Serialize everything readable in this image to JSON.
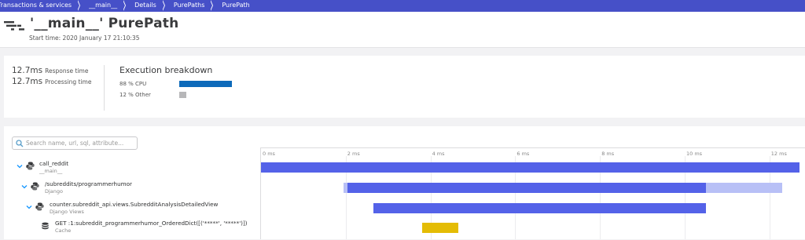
{
  "breadcrumb": [
    {
      "label": "Transactions & services"
    },
    {
      "label": "__main__"
    },
    {
      "label": "Details"
    },
    {
      "label": "PurePaths"
    },
    {
      "label": "PurePath"
    }
  ],
  "header": {
    "title": "'__main__' PurePath",
    "start_time": "Start time: 2020 January 17 21:10:35"
  },
  "summary": {
    "response_time": {
      "value": "12.7ms",
      "label": "Response time"
    },
    "processing_time": {
      "value": "12.7ms",
      "label": "Processing time"
    },
    "breakdown": {
      "title": "Execution breakdown",
      "rows": [
        {
          "label": "88 % CPU",
          "percent": 88,
          "color": "#0d6aba"
        },
        {
          "label": "12 % Other",
          "percent": 12,
          "color": "#b7b7b9"
        }
      ]
    }
  },
  "search": {
    "placeholder": "Search name, url, sql, attribute...",
    "value": ""
  },
  "timeline": {
    "ticks": [
      "0 ms",
      "2 ms",
      "4 ms",
      "6 ms",
      "8 ms",
      "10 ms",
      "12 ms"
    ],
    "colors": {
      "execution": "#5462e8",
      "waiting": "#b8c0f6",
      "cache": "#e4bc05"
    },
    "rows": [
      {
        "name": "call_reddit",
        "sub": "__main__",
        "icon": "python-icon",
        "expanded": true,
        "level": 0,
        "segments": [
          {
            "kind": "execution",
            "start_ms": 0.0,
            "end_ms": 12.7
          }
        ]
      },
      {
        "name": "/subreddits/programmerhumor",
        "sub": "Django",
        "icon": "python-icon",
        "expanded": true,
        "level": 1,
        "segments": [
          {
            "kind": "waiting",
            "start_ms": 1.95,
            "end_ms": 2.05
          },
          {
            "kind": "execution",
            "start_ms": 2.05,
            "end_ms": 10.5
          },
          {
            "kind": "waiting",
            "start_ms": 10.5,
            "end_ms": 12.3
          }
        ]
      },
      {
        "name": "counter.subreddit_api.views.SubredditAnalysisDetailedView",
        "sub": "Django Views",
        "icon": "python-icon",
        "expanded": true,
        "level": 2,
        "segments": [
          {
            "kind": "execution",
            "start_ms": 2.65,
            "end_ms": 10.5
          }
        ]
      },
      {
        "name": "GET :1:subreddit_programmerhumor_OrderedDict([('*****', '*****')])",
        "sub": "Cache",
        "icon": "database-icon",
        "expanded": false,
        "level": 3,
        "segments": [
          {
            "kind": "cache",
            "start_ms": 3.8,
            "end_ms": 4.65
          }
        ]
      }
    ]
  }
}
